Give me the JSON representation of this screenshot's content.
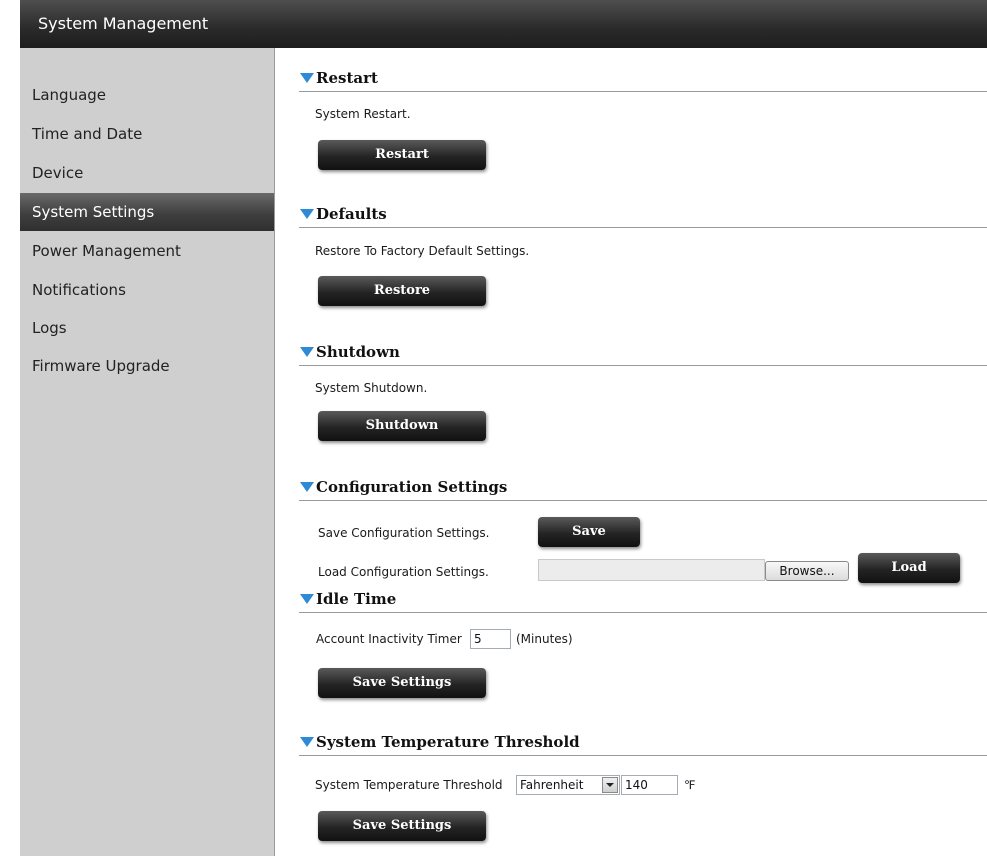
{
  "window": {
    "title": "System Management"
  },
  "sidebar": {
    "items": [
      {
        "label": "Language"
      },
      {
        "label": "Time and Date"
      },
      {
        "label": "Device"
      },
      {
        "label": "System Settings",
        "active": true
      },
      {
        "label": "Power Management"
      },
      {
        "label": "Notifications"
      },
      {
        "label": "Logs"
      },
      {
        "label": "Firmware Upgrade"
      }
    ]
  },
  "restart": {
    "title": "Restart",
    "description": "System Restart.",
    "button": "Restart"
  },
  "defaults": {
    "title": "Defaults",
    "description": "Restore To Factory Default Settings.",
    "button": "Restore"
  },
  "shutdown": {
    "title": "Shutdown",
    "description": "System Shutdown.",
    "button": "Shutdown"
  },
  "configuration": {
    "title": "Configuration Settings",
    "save_label": "Save Configuration Settings.",
    "save_button": "Save",
    "load_label": "Load Configuration Settings.",
    "file_value": "",
    "browse_button": "Browse...",
    "load_button": "Load"
  },
  "idle_time": {
    "title": "Idle Time",
    "label": "Account Inactivity Timer",
    "value": "5",
    "unit": "(Minutes)",
    "button": "Save Settings"
  },
  "temperature": {
    "title": "System Temperature Threshold",
    "label": "System Temperature Threshold",
    "unit_select": "Fahrenheit",
    "value": "140",
    "unit_symbol": "℉",
    "button": "Save Settings"
  },
  "colors": {
    "accent_triangle": "#2e8ad6",
    "titlebar": "#2a2a2a",
    "sidebar": "#cfcfcf",
    "button": "#242424"
  }
}
